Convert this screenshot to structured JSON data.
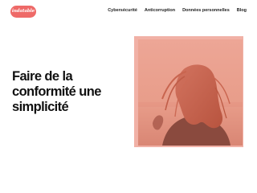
{
  "brand": {
    "logo_text": "indatable"
  },
  "nav": {
    "items": [
      {
        "label": "Cybersécurité"
      },
      {
        "label": "Anticorruption"
      },
      {
        "label": "Données personnelles"
      },
      {
        "label": "Blog"
      }
    ]
  },
  "hero": {
    "headline": "Faire de la conformité une simplicité",
    "image": {
      "subject": "woman-with-windblown-hair-photo",
      "tint_color": "#e99c8a",
      "frame_color": "#f1b1a6"
    }
  },
  "colors": {
    "brand": "#ee6a68",
    "text": "#111111",
    "background": "#ffffff"
  }
}
